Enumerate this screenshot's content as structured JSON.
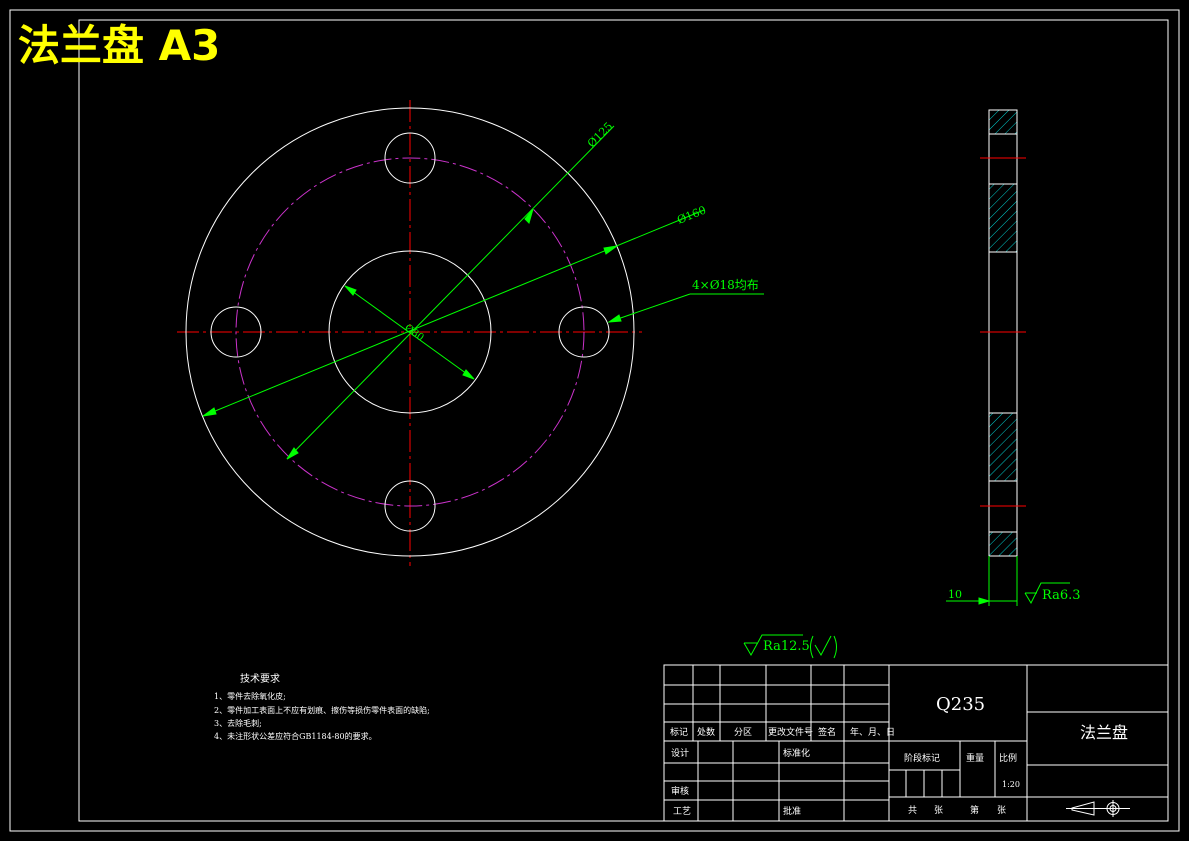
{
  "title": "法兰盘 A3",
  "colors": {
    "background": "#000000",
    "outline": "#ffffff",
    "title": "#ffff00",
    "dimension": "#00ff00",
    "centerline": "#ff0000",
    "pitch_circle": "#cc33cc",
    "hatch": "#00cccc"
  },
  "front_view": {
    "dim_outer": "Ø125",
    "dim_pitch": "Ø160",
    "dim_holes": "4×Ø18均布",
    "dim_bore": "Ø80"
  },
  "side_view": {
    "thickness": "10",
    "roughness_face": "Ra6.3"
  },
  "general_roughness": "Ra12.5",
  "tech_requirements": {
    "heading": "技术要求",
    "items": [
      "1、零件去除氧化皮;",
      "2、零件加工表面上不应有划痕、擦伤等损伤零件表面的缺陷;",
      "3、去除毛刺;",
      "4、未注形状公差应符合GB1184-80的要求。"
    ]
  },
  "title_block": {
    "material": "Q235",
    "part_name": "法兰盘",
    "scale": "1:20",
    "headers": {
      "mark": "标记",
      "count": "处数",
      "zone": "分区",
      "change_doc": "更改文件号",
      "signature": "签名",
      "date": "年、月、日",
      "design": "设计",
      "standardization": "标准化",
      "review": "审核",
      "process": "工艺",
      "approve": "批准",
      "stage_mark": "阶段标记",
      "weight": "重量",
      "ratio": "比例",
      "total": "共",
      "sheets": "张",
      "no": "第",
      "sheet": "张"
    }
  }
}
